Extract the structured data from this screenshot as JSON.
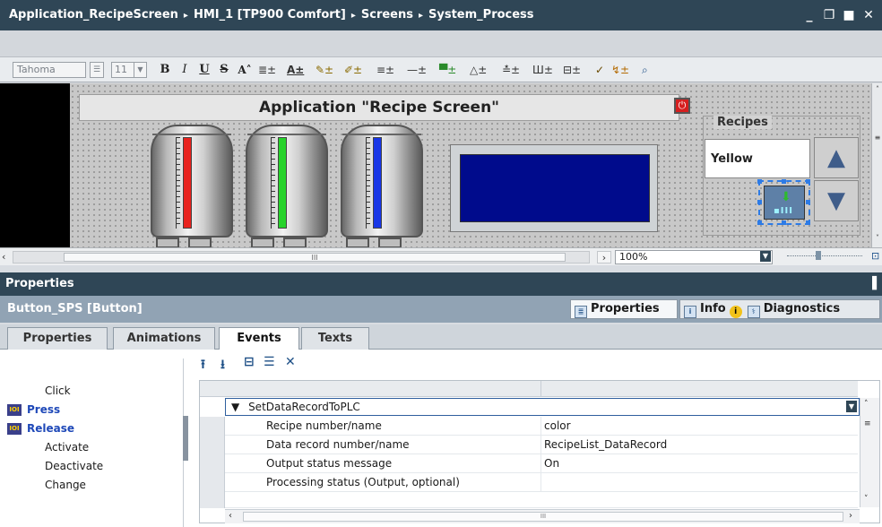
{
  "window": {
    "breadcrumb": [
      "Application_RecipeScreen",
      "HMI_1 [TP900 Comfort]",
      "Screens",
      "System_Process"
    ],
    "separator": "▸",
    "controls": [
      "_",
      "❐",
      "■",
      "✕"
    ]
  },
  "format_toolbar": {
    "font": "Tahoma",
    "font_size": "11",
    "bold": "B",
    "italic": "I",
    "underline": "U",
    "strike": "S",
    "superscript": "A˄"
  },
  "hmi": {
    "title": "Application \"Recipe Screen\"",
    "recipes_label": "Recipes",
    "recipe_value": "Yellow",
    "tanks": [
      {
        "color": "#e8231f",
        "level": 1.0
      },
      {
        "color": "#27d32b",
        "level": 1.0
      },
      {
        "color": "#1836e6",
        "level": 1.0
      }
    ],
    "up_arrow": "▲",
    "down_arrow": "▼",
    "stop_icon": "⏻"
  },
  "editor_status": {
    "zoom": "100%",
    "scroll_marker": "III"
  },
  "properties": {
    "header": "Properties",
    "object_name": "Button_SPS [Button]",
    "right_tabs": {
      "properties": "Properties",
      "info": "Info",
      "diagnostics": "Diagnostics"
    },
    "left_tabs": [
      "Properties",
      "Animations",
      "Events",
      "Texts"
    ],
    "events": [
      "Click",
      "Press",
      "Release",
      "Activate",
      "Deactivate",
      "Change"
    ],
    "function": {
      "name": "SetDataRecordToPLC",
      "params": [
        {
          "name": "Recipe number/name",
          "value": "color"
        },
        {
          "name": "Data record number/name",
          "value": "RecipeList_DataRecord"
        },
        {
          "name": "Output status message",
          "value": "On"
        },
        {
          "name": "Processing status (Output, optional)",
          "value": ""
        }
      ]
    },
    "scroll_marker": "III"
  }
}
